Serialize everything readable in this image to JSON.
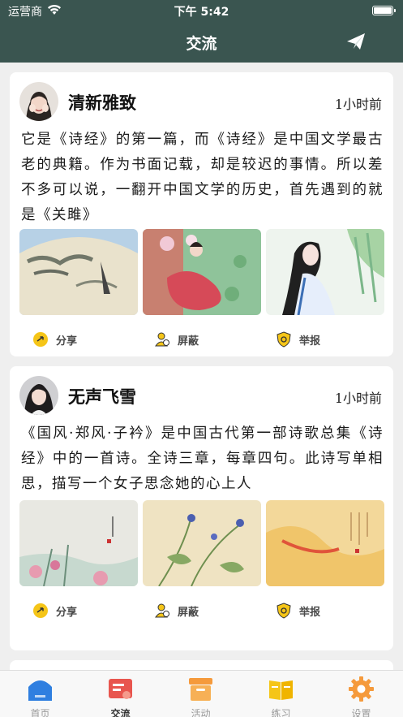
{
  "status_bar": {
    "carrier": "运营商",
    "time": "下午 5:42"
  },
  "nav": {
    "title": "交流"
  },
  "posts": [
    {
      "name": "清新雅致",
      "time": "1小时前",
      "text": "它是《诗经》的第一篇，而《诗经》是中国文学最古老的典籍。作为书面记载，却是较迟的事情。所以差不多可以说，一翻开中国文学的历史，首先遇到的就是《关雎》"
    },
    {
      "name": "无声飞雪",
      "time": "1小时前",
      "text": "《国风·郑风·子衿》是中国古代第一部诗歌总集《诗经》中的一首诗。全诗三章，每章四句。此诗写单相思，描写一个女子思念她的心上人"
    }
  ],
  "actions": {
    "share": "分享",
    "block": "屏蔽",
    "report": "举报"
  },
  "tabs": [
    "首页",
    "交流",
    "活动",
    "练习",
    "设置"
  ],
  "colors": {
    "header": "#3a5550",
    "action_icon": "#f5c518",
    "tab_active_red": "#e8554e",
    "tab_blue": "#2f7fe0",
    "tab_orange": "#f59a3c"
  }
}
